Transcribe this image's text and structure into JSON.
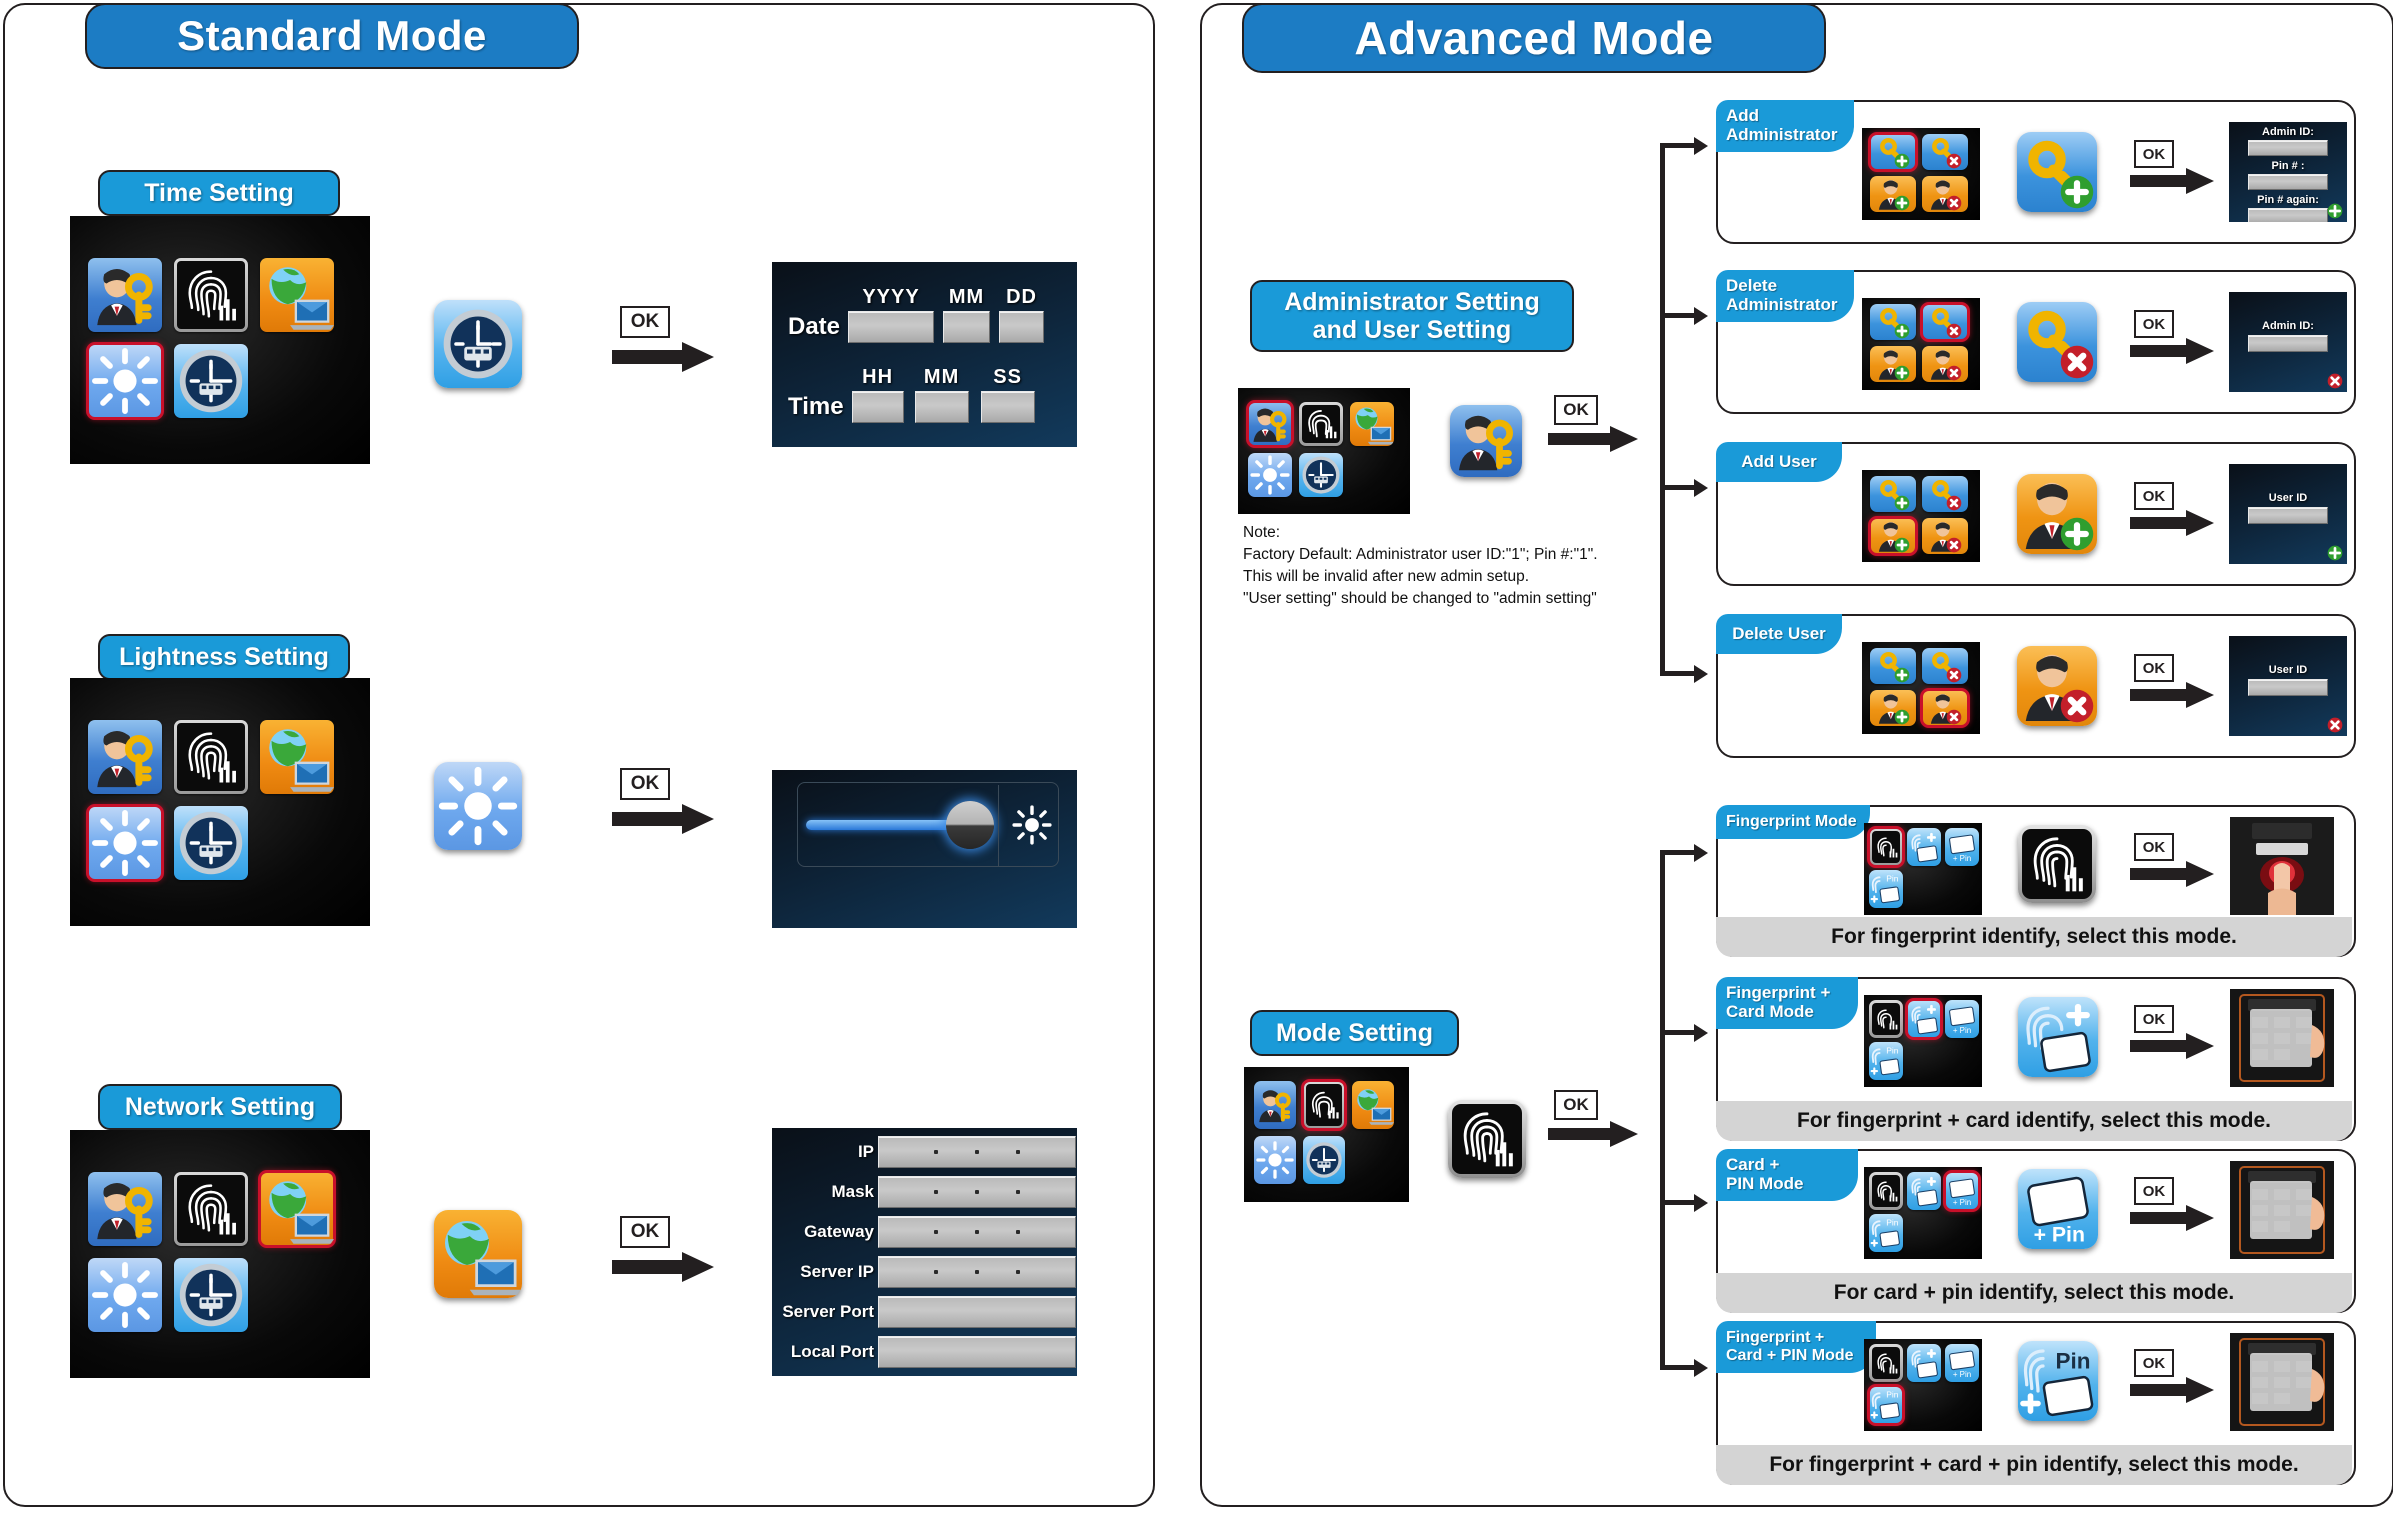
{
  "standard": {
    "banner": "Standard Mode",
    "sections": [
      {
        "label": "Time Setting",
        "menu_icons": [
          "admin-key-icon",
          "fingerprint-icon",
          "network-globe-icon",
          "brightness-icon",
          "clock-icon"
        ],
        "selected_icon": "clock-icon",
        "big_icon": "clock-icon",
        "ok_label": "OK",
        "result": {
          "type": "date-time-entry",
          "rows": [
            {
              "label": "Date",
              "fields": [
                "YYYY",
                "MM",
                "DD"
              ]
            },
            {
              "label": "Time",
              "fields": [
                "HH",
                "MM",
                "SS"
              ]
            }
          ]
        }
      },
      {
        "label": "Lightness Setting",
        "menu_icons": [
          "admin-key-icon",
          "fingerprint-icon",
          "network-globe-icon",
          "brightness-icon",
          "clock-icon"
        ],
        "selected_icon": "brightness-icon",
        "big_icon": "brightness-icon",
        "ok_label": "OK",
        "result": {
          "type": "brightness-slider",
          "slider_percent": 80,
          "icon": "sun-icon"
        }
      },
      {
        "label": "Network Setting",
        "menu_icons": [
          "admin-key-icon",
          "fingerprint-icon",
          "network-globe-icon",
          "brightness-icon",
          "clock-icon"
        ],
        "selected_icon": "network-globe-icon",
        "big_icon": "network-globe-icon",
        "ok_label": "OK",
        "result": {
          "type": "network-form",
          "rows": [
            {
              "label": "IP",
              "value": "",
              "dotted": true
            },
            {
              "label": "Mask",
              "value": "",
              "dotted": true
            },
            {
              "label": "Gateway",
              "value": "",
              "dotted": true
            },
            {
              "label": "Server IP",
              "value": "",
              "dotted": true
            },
            {
              "label": "Server Port",
              "value": "",
              "dotted": false
            },
            {
              "label": "Local Port",
              "value": "",
              "dotted": false
            }
          ]
        }
      }
    ]
  },
  "advanced": {
    "banner": "Advanced Mode",
    "groups": [
      {
        "label": "Administrator Setting\nand User  Setting",
        "label_line1": "Administrator Setting",
        "label_line2": "and User  Setting",
        "menu_icons": [
          "admin-key-icon",
          "fingerprint-icon",
          "network-globe-icon",
          "brightness-icon",
          "clock-icon"
        ],
        "selected_icon": "admin-key-icon",
        "big_icon": "admin-key-icon",
        "ok_label": "OK",
        "note_lines": [
          "Note:",
          "Factory Default: Administrator user ID:\"1\"; Pin #:\"1\".",
          "This will be invalid after new admin setup.",
          "\"User setting\" should be changed to \"admin setting\""
        ],
        "cards": [
          {
            "tab_line1": "Add",
            "tab_line2": "Administrator",
            "submenu_icons": [
              "key-add-icon",
              "key-delete-icon",
              "user-add-icon",
              "user-delete-icon"
            ],
            "selected_icon": "key-add-icon",
            "big_icon": "key-add-icon",
            "ok_label": "OK",
            "result_fields": [
              "Admin ID:",
              "Pin # :",
              "Pin # again:"
            ],
            "result_badge": "plus-badge-icon",
            "caption": ""
          },
          {
            "tab_line1": "Delete",
            "tab_line2": "Administrator",
            "submenu_icons": [
              "key-add-icon",
              "key-delete-icon",
              "user-add-icon",
              "user-delete-icon"
            ],
            "selected_icon": "key-delete-icon",
            "big_icon": "key-delete-icon",
            "ok_label": "OK",
            "result_fields": [
              "Admin ID:"
            ],
            "result_badge": "cross-badge-icon",
            "caption": ""
          },
          {
            "tab_line1": "Add User",
            "tab_line2": "",
            "submenu_icons": [
              "key-add-icon",
              "key-delete-icon",
              "user-add-icon",
              "user-delete-icon"
            ],
            "selected_icon": "user-add-icon",
            "big_icon": "user-add-icon",
            "ok_label": "OK",
            "result_fields": [
              "User ID"
            ],
            "result_badge": "plus-badge-icon",
            "caption": ""
          },
          {
            "tab_line1": "Delete User",
            "tab_line2": "",
            "submenu_icons": [
              "key-add-icon",
              "key-delete-icon",
              "user-add-icon",
              "user-delete-icon"
            ],
            "selected_icon": "user-delete-icon",
            "big_icon": "user-delete-icon",
            "ok_label": "OK",
            "result_fields": [
              "User ID"
            ],
            "result_badge": "cross-badge-icon",
            "caption": ""
          }
        ]
      },
      {
        "label": "Mode Setting",
        "menu_icons": [
          "admin-key-icon",
          "fingerprint-icon",
          "network-globe-icon",
          "brightness-icon",
          "clock-icon"
        ],
        "selected_icon": "fingerprint-icon",
        "big_icon": "fingerprint-icon",
        "ok_label": "OK",
        "cards": [
          {
            "tab_line1": "Fingerprint Mode",
            "tab_line2": "",
            "submenu_icons": [
              "fingerprint-icon",
              "fingerprint-card-icon",
              "card-pin-icon",
              "fingerprint-card-pin-icon"
            ],
            "selected_icon": "fingerprint-icon",
            "big_icon": "fingerprint-icon",
            "ok_label": "OK",
            "result_photo": "finger-on-sensor-photo",
            "caption": "For fingerprint  identify, select this mode."
          },
          {
            "tab_line1": "Fingerprint +",
            "tab_line2": "Card Mode",
            "submenu_icons": [
              "fingerprint-icon",
              "fingerprint-card-icon",
              "card-pin-icon",
              "fingerprint-card-pin-icon"
            ],
            "selected_icon": "fingerprint-card-icon",
            "big_icon": "fingerprint-card-icon",
            "ok_label": "OK",
            "result_photo": "card-on-reader-photo",
            "caption": "For fingerprint + card identify, select this mode."
          },
          {
            "tab_line1": "Card +",
            "tab_line2": "PIN Mode",
            "submenu_icons": [
              "fingerprint-icon",
              "fingerprint-card-icon",
              "card-pin-icon",
              "fingerprint-card-pin-icon"
            ],
            "selected_icon": "card-pin-icon",
            "big_icon": "card-pin-icon",
            "ok_label": "OK",
            "result_photo": "card-on-reader-photo",
            "caption": "For card + pin identify, select this mode."
          },
          {
            "tab_line1": "Fingerprint +",
            "tab_line2": "Card + PIN Mode",
            "submenu_icons": [
              "fingerprint-icon",
              "fingerprint-card-icon",
              "card-pin-icon",
              "fingerprint-card-pin-icon"
            ],
            "selected_icon": "fingerprint-card-pin-icon",
            "big_icon": "fingerprint-card-pin-icon",
            "ok_label": "OK",
            "result_photo": "card-on-reader-photo",
            "caption": "For fingerprint + card + pin identify, select this mode."
          }
        ]
      }
    ]
  },
  "colors": {
    "banner_blue": "#1c7cc4",
    "pill_blue": "#1a9ad8",
    "outline": "#231f20",
    "selection_red": "#c9102a",
    "caption_gray": "#d4d4d4",
    "screen_dark": "#0d2236"
  },
  "labels": {
    "pin_small": "Pin",
    "plus_pin": "+ Pin"
  }
}
